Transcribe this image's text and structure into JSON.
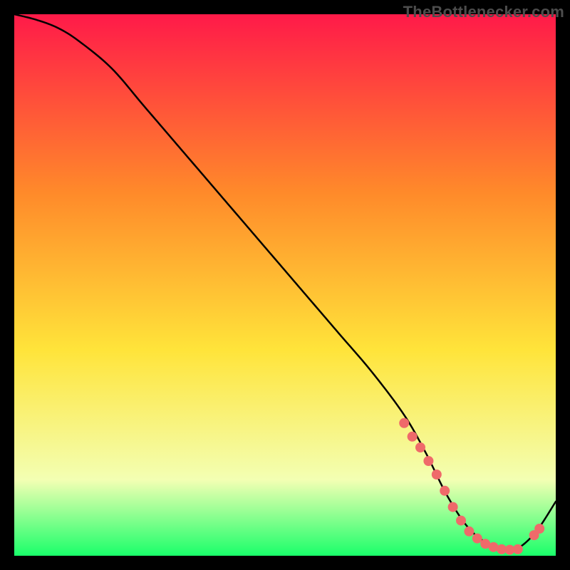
{
  "watermark": "TheBottlenecker.com",
  "colors": {
    "grad_top": "#ff1a49",
    "grad_orange": "#ff8a2a",
    "grad_yellow": "#ffe43a",
    "grad_pale": "#f3ffb3",
    "grad_green": "#1aff6a",
    "curve": "#000000",
    "points": "#ef6a6a",
    "bg": "#000000"
  },
  "chart_data": {
    "type": "line",
    "title": "",
    "xlabel": "",
    "ylabel": "",
    "xlim": [
      0,
      100
    ],
    "ylim": [
      0,
      100
    ],
    "x": [
      0,
      4,
      8,
      12,
      18,
      24,
      30,
      36,
      42,
      48,
      54,
      60,
      66,
      72,
      76,
      80,
      84,
      88,
      92,
      96,
      100
    ],
    "values": [
      100,
      99,
      97.5,
      95,
      90,
      83,
      76,
      69,
      62,
      55,
      48,
      41,
      34,
      26,
      19,
      11,
      5,
      2,
      1,
      4,
      10
    ],
    "highlight_points": {
      "x": [
        72,
        73.5,
        75,
        76.5,
        78,
        79.5,
        81,
        82.5,
        84,
        85.5,
        87,
        88.5,
        90,
        91.5,
        93,
        96,
        97
      ],
      "y": [
        24.5,
        22,
        20,
        17.5,
        15,
        12,
        9,
        6.5,
        4.5,
        3.2,
        2.2,
        1.6,
        1.2,
        1.1,
        1.2,
        3.8,
        5
      ]
    }
  }
}
